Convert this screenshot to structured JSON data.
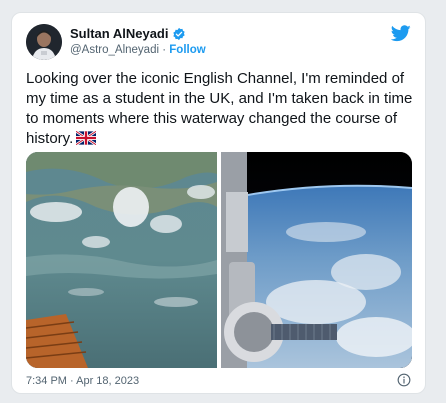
{
  "tweet": {
    "display_name": "Sultan AlNeyadi",
    "handle": "@Astro_Alneyadi",
    "separator": " · ",
    "follow_label": "Follow",
    "text": "Looking over the iconic English Channel, I'm reminded of my time as a student in the UK, and I'm taken back in time to moments where this waterway changed the course of history.",
    "timestamp": "7:34 PM · Apr 18, 2023"
  },
  "icons": {
    "verified": "verified-badge-icon",
    "brand": "twitter-bird-icon",
    "flag": "uk-flag-icon",
    "info": "info-icon"
  },
  "colors": {
    "brand_blue": "#1d9bf0",
    "text_primary": "#0f1419",
    "text_secondary": "#536471"
  }
}
